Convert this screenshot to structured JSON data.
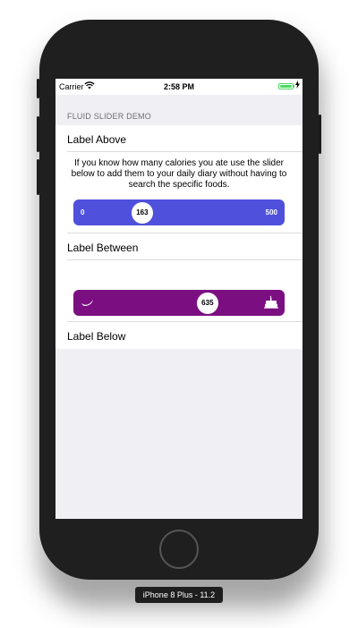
{
  "status_bar": {
    "carrier": "Carrier",
    "time": "2:58 PM"
  },
  "section_header": "FLUID SLIDER DEMO",
  "cells": {
    "label_above": "Label Above",
    "description": "If you know how many calories you ate use the slider below to add them to your daily diary without having to search the specific foods.",
    "label_between": "Label Between",
    "label_below": "Label Below"
  },
  "slider_1": {
    "min_label": "0",
    "max_label": "500",
    "value": "163",
    "fraction": 0.326,
    "color": "#4f51dc"
  },
  "slider_2": {
    "value": "635",
    "fraction": 0.635,
    "color": "#7b0f82",
    "min_icon": "moon-icon",
    "max_icon": "cake-icon"
  },
  "device_label": "iPhone 8 Plus - 11.2"
}
